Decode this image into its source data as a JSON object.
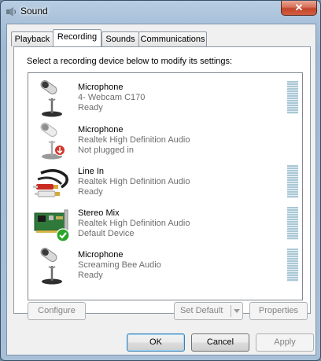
{
  "window": {
    "title": "Sound",
    "close_label": "✕",
    "icon": "speaker-icon"
  },
  "tabs": [
    {
      "label": "Playback",
      "active": false
    },
    {
      "label": "Recording",
      "active": true
    },
    {
      "label": "Sounds",
      "active": false
    },
    {
      "label": "Communications",
      "active": false
    }
  ],
  "instruction": "Select a recording device below to modify its settings:",
  "devices": [
    {
      "name": "Microphone",
      "driver": "4- Webcam C170",
      "status": "Ready",
      "icon": "microphone-icon",
      "has_meter": true
    },
    {
      "name": "Microphone",
      "driver": "Realtek High Definition Audio",
      "status": "Not plugged in",
      "icon": "microphone-unplugged-icon",
      "has_meter": false
    },
    {
      "name": "Line In",
      "driver": "Realtek High Definition Audio",
      "status": "Ready",
      "icon": "rca-cable-icon",
      "has_meter": true
    },
    {
      "name": "Stereo Mix",
      "driver": "Realtek High Definition Audio",
      "status": "Default Device",
      "icon": "sound-card-icon",
      "has_meter": true
    },
    {
      "name": "Microphone",
      "driver": "Screaming Bee Audio",
      "status": "Ready",
      "icon": "microphone-icon",
      "has_meter": true
    }
  ],
  "buttons": {
    "configure": "Configure",
    "set_default": "Set Default",
    "properties": "Properties",
    "ok": "OK",
    "cancel": "Cancel",
    "apply": "Apply"
  },
  "colors": {
    "accent": "#3c7fb1",
    "meter": "#a9c8d6",
    "check": "#2aa52a",
    "unplug": "#d0372a"
  }
}
